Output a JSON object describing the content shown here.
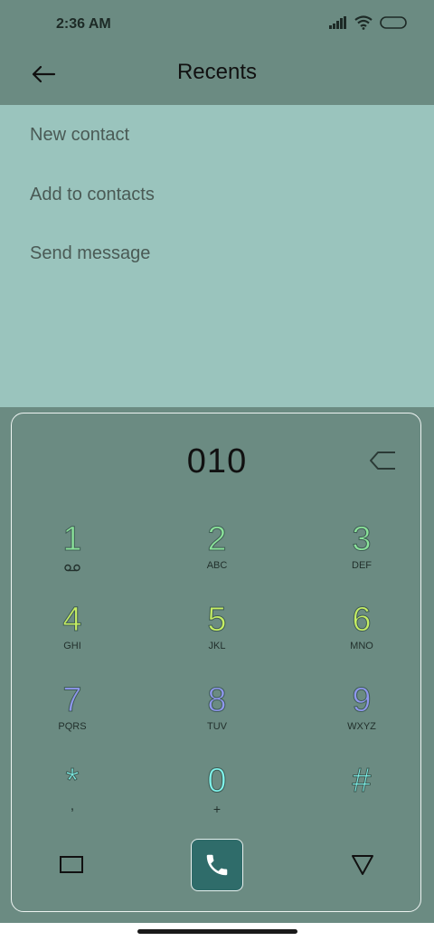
{
  "status": {
    "time": "2:36 AM"
  },
  "header": {
    "title": "Recents"
  },
  "menu": {
    "items": [
      {
        "label": "New contact"
      },
      {
        "label": "Add to contacts"
      },
      {
        "label": "Send message"
      }
    ]
  },
  "dialer": {
    "number": "010",
    "keys": [
      {
        "digit": "1",
        "letters": ""
      },
      {
        "digit": "2",
        "letters": "ABC"
      },
      {
        "digit": "3",
        "letters": "DEF"
      },
      {
        "digit": "4",
        "letters": "GHI"
      },
      {
        "digit": "5",
        "letters": "JKL"
      },
      {
        "digit": "6",
        "letters": "MNO"
      },
      {
        "digit": "7",
        "letters": "PQRS"
      },
      {
        "digit": "8",
        "letters": "TUV"
      },
      {
        "digit": "9",
        "letters": "WXYZ"
      },
      {
        "digit": "*",
        "letters": ","
      },
      {
        "digit": "0",
        "letters": "+"
      },
      {
        "digit": "#",
        "letters": ""
      }
    ],
    "icons": {
      "key1_sub": "voicemail-icon",
      "backspace": "backspace-icon",
      "call": "phone-icon"
    }
  },
  "colors": {
    "background": "#6b8b82",
    "menu_panel": "#9ac4bd",
    "call_button": "#2f6c6a"
  }
}
